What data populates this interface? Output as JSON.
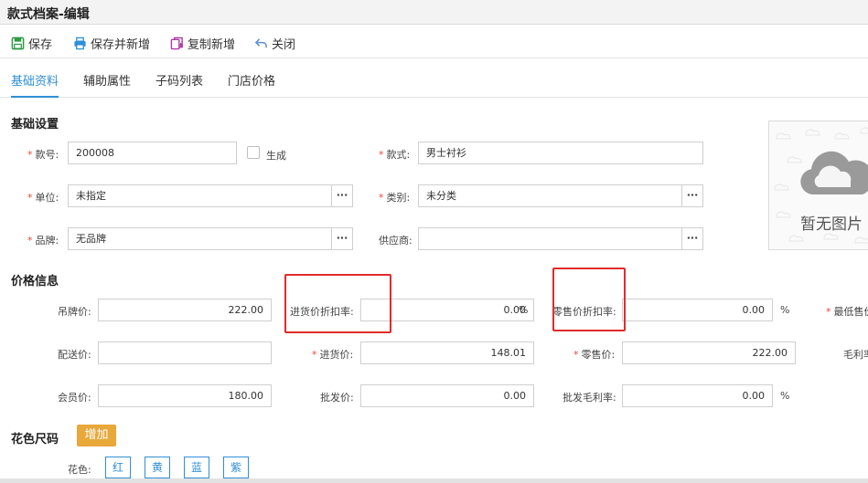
{
  "window": {
    "title": "款式档案-编辑"
  },
  "toolbar": {
    "save": "保存",
    "save_new": "保存并新增",
    "copy_new": "复制新增",
    "close": "关闭"
  },
  "tabs": [
    "基础资料",
    "辅助属性",
    "子码列表",
    "门店价格"
  ],
  "basic": {
    "section_title": "基础设置",
    "style_no_label": "款号:",
    "style_no_value": "200008",
    "generate_label": "生成",
    "style_label": "款式:",
    "style_value": "男士衬衫",
    "unit_label": "单位:",
    "unit_value": "未指定",
    "category_label": "类别:",
    "category_value": "未分类",
    "brand_label": "品牌:",
    "brand_value": "无品牌",
    "supplier_label": "供应商:",
    "supplier_value": "",
    "more": "···",
    "no_image": "暂无图片"
  },
  "price": {
    "section_title": "价格信息",
    "tag_price_label": "吊牌价:",
    "tag_price": "222.00",
    "purchase_discount_label": "进货价折扣率:",
    "purchase_discount": "0.00",
    "retail_discount_label": "零售价折扣率:",
    "retail_discount": "0.00",
    "min_price_label": "最低售价",
    "delivery_price_label": "配送价:",
    "delivery_price": "",
    "purchase_price_label": "进货价:",
    "purchase_price": "148.01",
    "retail_price_label": "零售价:",
    "retail_price": "222.00",
    "gross_margin_label": "毛利率",
    "member_price_label": "会员价:",
    "member_price": "180.00",
    "wholesale_price_label": "批发价:",
    "wholesale_price": "0.00",
    "wholesale_margin_label": "批发毛利率:",
    "wholesale_margin": "0.00",
    "percent": "%"
  },
  "color_size": {
    "section_title": "花色尺码",
    "add_label": "增加",
    "color_label": "花色:",
    "colors": [
      "红",
      "黄",
      "蓝",
      "紫"
    ]
  },
  "colors": {
    "accent": "#2f8fd6",
    "required": "#e34a3a",
    "add_button": "#e8a83a",
    "highlight": "#e12b2b"
  }
}
